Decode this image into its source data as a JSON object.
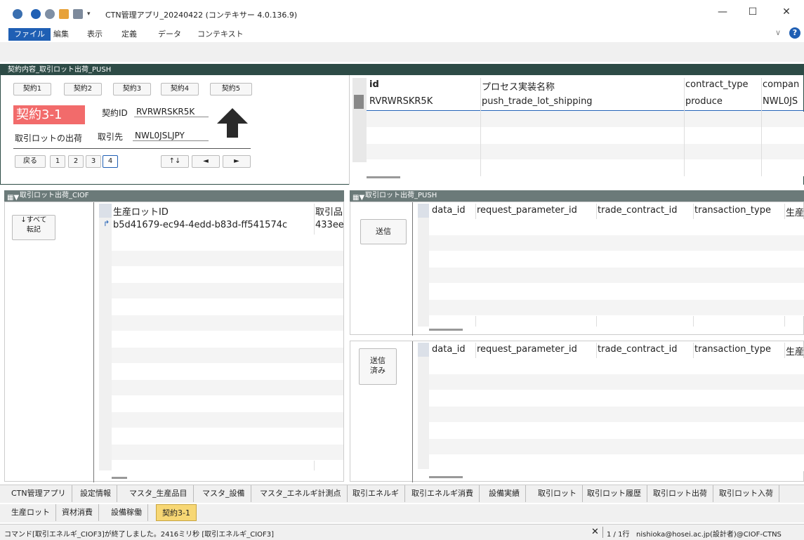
{
  "window": {
    "title": "CTN管理アプリ_20240422 (コンテキサー 4.0.136.9)",
    "minimize": "—",
    "maximize": "☐",
    "close": "✕"
  },
  "menu": [
    "ファイル",
    "編集",
    "表示",
    "定義",
    "データ",
    "コンテキスト"
  ],
  "top": {
    "header": "契約内容_取引ロット出荷_PUSH",
    "contract_tabs": [
      "契約1",
      "契約2",
      "契約3",
      "契約4",
      "契約5"
    ],
    "badge": "契約3-1",
    "contract_id_label": "契約ID",
    "contract_id_value": "RVRWRSKR5K",
    "process_label": "取引ロットの出荷",
    "partner_label": "取引先",
    "partner_value": "NWL0JSLJPY",
    "back": "戻る",
    "pages": [
      "1",
      "2",
      "3",
      "4"
    ],
    "sort": "↑↓",
    "prev": "◄",
    "next": "►",
    "grid": {
      "headers": [
        "id",
        "プロセス実装名称",
        "contract_type",
        "compan"
      ],
      "rows": [
        [
          "RVRWRSKR5K",
          "push_trade_lot_shipping",
          "produce",
          "NWL0JS"
        ]
      ]
    }
  },
  "left_panel": {
    "header": "取引ロット出荷_CIOF",
    "transfer_button": "↓すべて\n転記",
    "headers": [
      "生産ロットID",
      "取引品"
    ],
    "rows": [
      [
        "b5d41679-ec94-4edd-b83d-ff541574c",
        "433ee"
      ]
    ]
  },
  "right_panel": {
    "header": "取引ロット出荷_PUSH",
    "send_button": "送信",
    "sent_button": "送信\n済み",
    "headers": [
      "data_id",
      "request_parameter_id",
      "trade_contract_id",
      "transaction_type",
      "生産"
    ]
  },
  "bottom_tabs_row1": [
    "CTN管理アプリ",
    "設定情報",
    "マスタ_生産品目",
    "マスタ_設備",
    "マスタ_エネルギ計測点",
    "取引エネルギ",
    "取引エネルギ消費",
    "設備実績",
    "取引ロット",
    "取引ロット履歴",
    "取引ロット出荷",
    "取引ロット入荷"
  ],
  "bottom_tabs_row2": [
    "生産ロット",
    "資材消費",
    "設備稼働",
    "契約3-1"
  ],
  "status": {
    "message": "コマンド[取引エネルギ_CIOF3]が終了しました。2416ミリ秒 [取引エネルギ_CIOF3]",
    "close": "✕",
    "count": "1 / 1行",
    "user": "nishioka@hosei.ac.jp(設計者)@CIOF-CTNS"
  },
  "colors": {
    "accent": "#1f5fb4",
    "header_bg": "#2d4b46",
    "badge_bg": "#f26b6b",
    "active_tab": "#f7d774"
  }
}
